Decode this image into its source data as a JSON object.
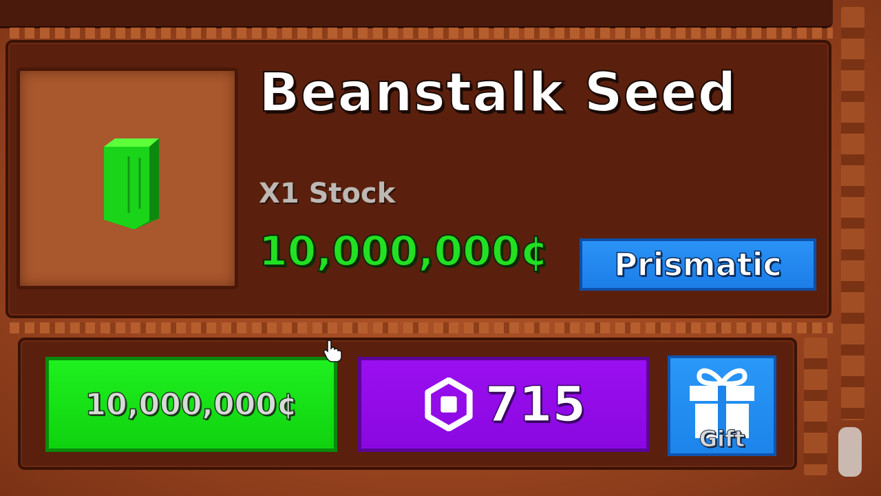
{
  "item": {
    "title": "Beanstalk Seed",
    "stock": "X1 Stock",
    "price": "10,000,000¢",
    "rarity": "Prismatic",
    "icon": "green-seed-icon"
  },
  "purchase": {
    "cash_label": "10,000,000¢",
    "robux_amount": "715",
    "robux_icon": "robux-icon",
    "gift_label": "Gift",
    "gift_icon": "gift-icon"
  },
  "colors": {
    "price_green": "#22e022",
    "rarity_blue": "#1c7ee8",
    "cash_button": "#0fd20f",
    "robux_button": "#8a08e0",
    "gift_button": "#1c84ea",
    "panel_brown": "#5a200d"
  }
}
